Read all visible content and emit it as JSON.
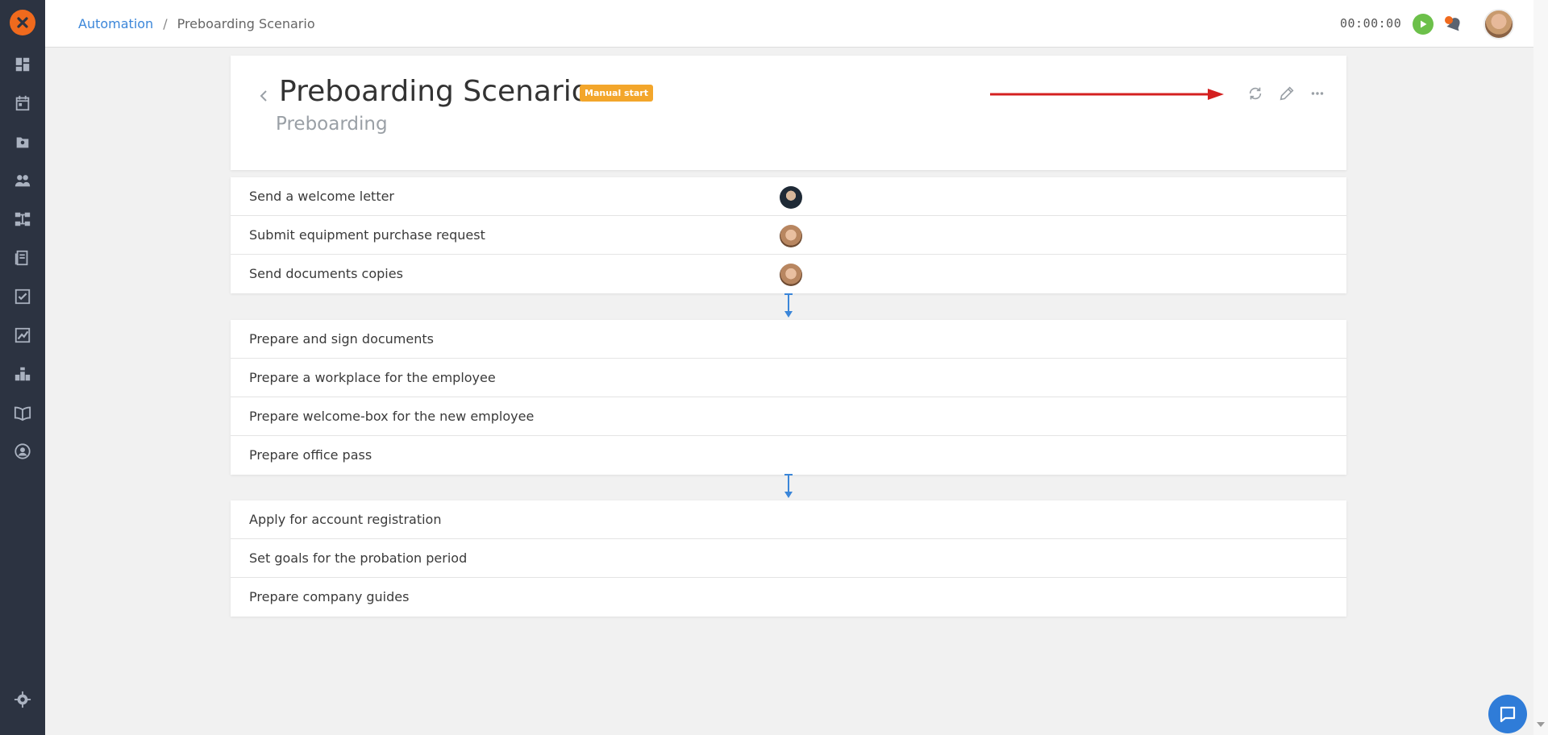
{
  "breadcrumb": {
    "parent": "Automation",
    "separator": "/",
    "current": "Preboarding Scenario"
  },
  "topbar": {
    "timer": "00:00:00"
  },
  "header": {
    "title": "Preboarding Scenario",
    "badge": "Manual start",
    "subtitle": "Preboarding"
  },
  "groups": [
    {
      "tasks": [
        {
          "label": "Send a welcome letter",
          "assignee": "man-avatar"
        },
        {
          "label": "Submit equipment purchase request",
          "assignee": "woman-avatar"
        },
        {
          "label": "Send documents copies",
          "assignee": "woman-avatar"
        }
      ]
    },
    {
      "tasks": [
        {
          "label": "Prepare and sign documents"
        },
        {
          "label": "Prepare a workplace for the employee"
        },
        {
          "label": "Prepare welcome-box for the new employee"
        },
        {
          "label": "Prepare office pass"
        }
      ]
    },
    {
      "tasks": [
        {
          "label": "Apply for account registration"
        },
        {
          "label": "Set goals for the probation period"
        },
        {
          "label": "Prepare company guides"
        }
      ]
    }
  ],
  "icons": {
    "sidebar": [
      "dashboard-icon",
      "calendar-icon",
      "contacts-icon",
      "people-icon",
      "workflow-icon",
      "library-icon",
      "tasks-icon",
      "reports-icon",
      "apps-icon",
      "knowledge-icon",
      "profile-icon",
      "settings-icon"
    ],
    "header_actions": [
      "refresh-icon",
      "edit-icon",
      "more-icon"
    ]
  },
  "colors": {
    "sidebar_bg": "#2c3341",
    "accent": "#3b86d9",
    "logo": "#f06a1d",
    "badge": "#f3a62b",
    "arrow": "#d42020",
    "play": "#6cc04a"
  }
}
